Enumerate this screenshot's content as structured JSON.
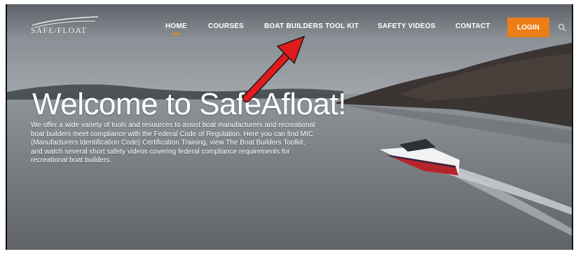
{
  "brand": {
    "logo_text": "SAFE/FLOAT"
  },
  "nav": {
    "items": [
      {
        "label": "HOME",
        "active": true
      },
      {
        "label": "COURSES",
        "active": false
      },
      {
        "label": "BOAT BUILDERS TOOL KIT",
        "active": false
      },
      {
        "label": "SAFETY VIDEOS",
        "active": false
      },
      {
        "label": "CONTACT",
        "active": false
      }
    ],
    "login_label": "LOGIN",
    "search_icon": "search-icon"
  },
  "hero": {
    "title": "Welcome to SafeAfloat!",
    "intro_lines": [
      "We offer a wide variety of tools and resources to assist boat manufacturers and recreational",
      "boat builders meet compliance with the Federal Code of Regulation. Here you can find MIC",
      "(Manufacturers Identification Code) Certification Training, view The Boat Builders Toolkit,",
      "and watch several short safety videos covering federal compliance requirements for",
      "recreational boat builders."
    ]
  },
  "colors": {
    "accent_orange": "#ec7d17",
    "annotation_arrow": "#e01b1b",
    "text_light": "#ffffff"
  }
}
